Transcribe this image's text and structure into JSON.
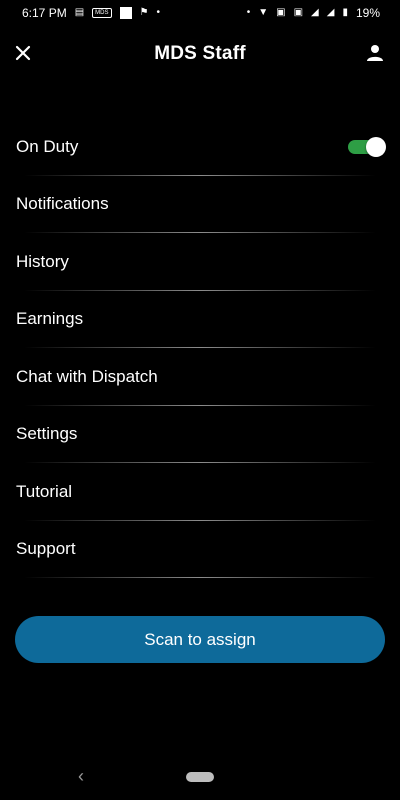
{
  "status_bar": {
    "time": "6:17 PM",
    "app_label": "MDS",
    "battery": "19%"
  },
  "header": {
    "title": "MDS Staff",
    "close_icon": "close-icon",
    "profile_icon": "person-icon"
  },
  "menu": {
    "items": [
      {
        "label": "On Duty"
      },
      {
        "label": "Notifications"
      },
      {
        "label": "History"
      },
      {
        "label": "Earnings"
      },
      {
        "label": "Chat with Dispatch"
      },
      {
        "label": "Settings"
      },
      {
        "label": "Tutorial"
      },
      {
        "label": "Support"
      }
    ],
    "on_duty_toggle": true
  },
  "action": {
    "scan_label": "Scan to assign"
  },
  "colors": {
    "background": "#000000",
    "toggle_on": "#2e9e45",
    "primary_button": "#0e6a9a"
  }
}
